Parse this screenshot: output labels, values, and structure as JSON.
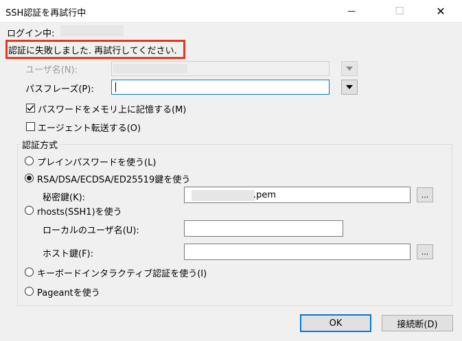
{
  "window": {
    "title": "SSH認証を再試行中",
    "minimize_glyph": "—",
    "maximize_glyph": "☐",
    "close_glyph": "✕"
  },
  "status": {
    "logging_in_label": "ログイン中:",
    "error_message": "認証に失敗しました. 再試行してください."
  },
  "form": {
    "username_label": "ユーザ名(N):",
    "passphrase_label": "パスフレーズ(P):",
    "passphrase_value": "",
    "remember_password_label": "パスワードをメモリ上に記憶する(M)",
    "remember_password_checked": true,
    "agent_forwarding_label": "エージェント転送する(O)",
    "agent_forwarding_checked": false
  },
  "auth": {
    "group_title": "認証方式",
    "selected": "rsa",
    "plain_password_label": "プレインパスワードを使う(L)",
    "rsa_label": "RSA/DSA/ECDSA/ED25519鍵を使う",
    "private_key_label": "秘密鍵(K):",
    "private_key_value": ".pem",
    "browse_label": "...",
    "rhosts_label": "rhosts(SSH1)を使う",
    "local_user_label": "ローカルのユーザ名(U):",
    "host_key_label": "ホスト鍵(F):",
    "keyboard_interactive_label": "キーボードインタラクティブ認証を使う(I)",
    "pageant_label": "Pageantを使う"
  },
  "buttons": {
    "ok": "OK",
    "disconnect": "接続断(D)"
  },
  "icons": {
    "dropdown": "triangle-down-icon",
    "check": "checkmark-icon"
  }
}
